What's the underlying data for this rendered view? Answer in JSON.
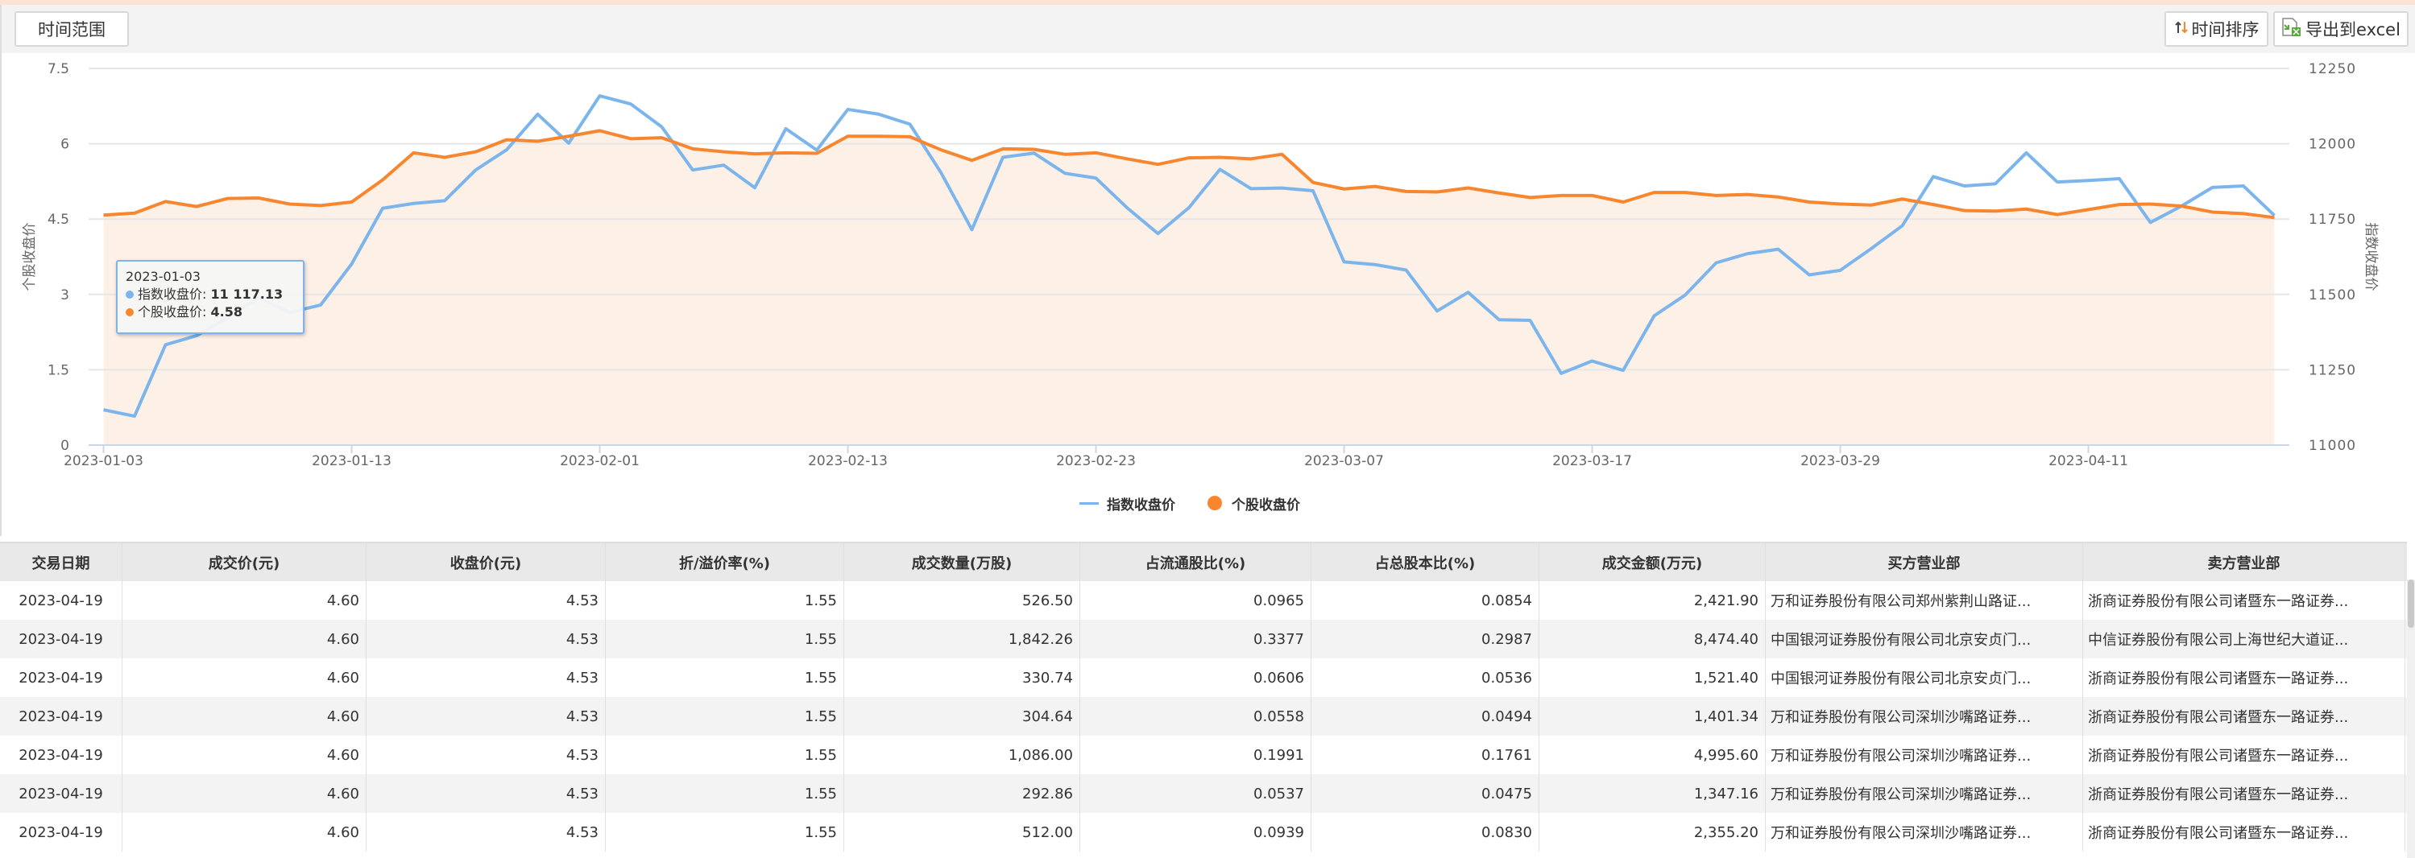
{
  "toolbar": {
    "range_label": "时间范围",
    "sort_label": "时间排序",
    "export_label": "导出到excel"
  },
  "tooltip": {
    "date": "2023-01-03",
    "index_label": "指数收盘价:",
    "index_value": "11 117.13",
    "stock_label": "个股收盘价:",
    "stock_value": "4.58"
  },
  "chart_data": {
    "type": "line",
    "left_axis": {
      "title": "个股收盘价",
      "ylim": [
        0,
        7.5
      ],
      "ticks": [
        "0",
        "1.5",
        "3",
        "4.5",
        "6",
        "7.5"
      ]
    },
    "right_axis": {
      "title": "指数收盘价",
      "ylim": [
        11000,
        12250
      ],
      "ticks": [
        "11000",
        "11250",
        "11500",
        "11750",
        "12000",
        "12250"
      ]
    },
    "x_tick_labels": [
      "2023-01-03",
      "2023-01-13",
      "2023-02-01",
      "2023-02-13",
      "2023-02-23",
      "2023-03-07",
      "2023-03-17",
      "2023-03-29",
      "2023-04-11"
    ],
    "x": [
      "2023-01-03",
      "2023-01-04",
      "2023-01-05",
      "2023-01-06",
      "2023-01-09",
      "2023-01-10",
      "2023-01-11",
      "2023-01-12",
      "2023-01-13",
      "2023-01-16",
      "2023-01-17",
      "2023-01-18",
      "2023-01-19",
      "2023-01-20",
      "2023-01-30",
      "2023-01-31",
      "2023-02-01",
      "2023-02-02",
      "2023-02-03",
      "2023-02-06",
      "2023-02-07",
      "2023-02-08",
      "2023-02-09",
      "2023-02-10",
      "2023-02-13",
      "2023-02-14",
      "2023-02-15",
      "2023-02-16",
      "2023-02-17",
      "2023-02-20",
      "2023-02-21",
      "2023-02-22",
      "2023-02-23",
      "2023-02-24",
      "2023-02-27",
      "2023-02-28",
      "2023-03-01",
      "2023-03-02",
      "2023-03-03",
      "2023-03-06",
      "2023-03-07",
      "2023-03-08",
      "2023-03-09",
      "2023-03-10",
      "2023-03-13",
      "2023-03-14",
      "2023-03-15",
      "2023-03-16",
      "2023-03-17",
      "2023-03-20",
      "2023-03-21",
      "2023-03-22",
      "2023-03-23",
      "2023-03-24",
      "2023-03-27",
      "2023-03-28",
      "2023-03-29",
      "2023-03-30",
      "2023-03-31",
      "2023-04-03",
      "2023-04-04",
      "2023-04-06",
      "2023-04-07",
      "2023-04-10",
      "2023-04-11",
      "2023-04-12",
      "2023-04-13",
      "2023-04-14",
      "2023-04-17",
      "2023-04-18",
      "2023-04-19"
    ],
    "series": [
      {
        "name": "指数收盘价",
        "axis": "right",
        "color": "#7cb5ec",
        "values": [
          11117.13,
          11096,
          11333,
          11363,
          11422,
          11489,
          11440,
          11465,
          11601,
          11786,
          11802,
          11811,
          11913,
          11980,
          12098,
          12002,
          12159,
          12132,
          12056,
          11913,
          11929,
          11854,
          12050,
          11979,
          12114,
          12098,
          12065,
          11905,
          11715,
          11955,
          11969,
          11902,
          11886,
          11788,
          11702,
          11788,
          11915,
          11851,
          11853,
          11844,
          11608,
          11599,
          11581,
          11445,
          11507,
          11416,
          11414,
          11238,
          11279,
          11248,
          11429,
          11498,
          11605,
          11635,
          11650,
          11565,
          11580,
          11652,
          11728,
          11891,
          11860,
          11867,
          11970,
          11873,
          11878,
          11884,
          11739,
          11793,
          11855,
          11860,
          11762
        ]
      },
      {
        "name": "个股收盘价",
        "axis": "left",
        "color": "#f7862e",
        "area": true,
        "values": [
          4.58,
          4.62,
          4.85,
          4.75,
          4.91,
          4.92,
          4.8,
          4.77,
          4.84,
          5.28,
          5.82,
          5.73,
          5.84,
          6.08,
          6.05,
          6.15,
          6.26,
          6.1,
          6.12,
          5.9,
          5.84,
          5.8,
          5.82,
          5.81,
          6.15,
          6.15,
          6.14,
          5.88,
          5.67,
          5.9,
          5.89,
          5.79,
          5.82,
          5.7,
          5.59,
          5.72,
          5.73,
          5.7,
          5.79,
          5.23,
          5.1,
          5.15,
          5.05,
          5.04,
          5.12,
          5.02,
          4.93,
          4.97,
          4.97,
          4.84,
          5.03,
          5.03,
          4.97,
          4.99,
          4.94,
          4.84,
          4.8,
          4.78,
          4.9,
          4.79,
          4.67,
          4.66,
          4.7,
          4.59,
          4.69,
          4.79,
          4.8,
          4.76,
          4.64,
          4.61,
          4.53
        ]
      }
    ],
    "legend": [
      "指数收盘价",
      "个股收盘价"
    ],
    "legend_position": "bottom-center",
    "grid": true
  },
  "table": {
    "columns": [
      "交易日期",
      "成交价(元)",
      "收盘价(元)",
      "折/溢价率(%)",
      "成交数量(万股)",
      "占流通股比(%)",
      "占总股本比(%)",
      "成交金额(万元)",
      "买方营业部",
      "卖方营业部"
    ],
    "rows": [
      [
        "2023-04-19",
        "4.60",
        "4.53",
        "1.55",
        "526.50",
        "0.0965",
        "0.0854",
        "2,421.90",
        "万和证券股份有限公司郑州紫荆山路证...",
        "浙商证券股份有限公司诸暨东一路证券..."
      ],
      [
        "2023-04-19",
        "4.60",
        "4.53",
        "1.55",
        "1,842.26",
        "0.3377",
        "0.2987",
        "8,474.40",
        "中国银河证券股份有限公司北京安贞门...",
        "中信证券股份有限公司上海世纪大道证..."
      ],
      [
        "2023-04-19",
        "4.60",
        "4.53",
        "1.55",
        "330.74",
        "0.0606",
        "0.0536",
        "1,521.40",
        "中国银河证券股份有限公司北京安贞门...",
        "浙商证券股份有限公司诸暨东一路证券..."
      ],
      [
        "2023-04-19",
        "4.60",
        "4.53",
        "1.55",
        "304.64",
        "0.0558",
        "0.0494",
        "1,401.34",
        "万和证券股份有限公司深圳沙嘴路证券...",
        "浙商证券股份有限公司诸暨东一路证券..."
      ],
      [
        "2023-04-19",
        "4.60",
        "4.53",
        "1.55",
        "1,086.00",
        "0.1991",
        "0.1761",
        "4,995.60",
        "万和证券股份有限公司深圳沙嘴路证券...",
        "浙商证券股份有限公司诸暨东一路证券..."
      ],
      [
        "2023-04-19",
        "4.60",
        "4.53",
        "1.55",
        "292.86",
        "0.0537",
        "0.0475",
        "1,347.16",
        "万和证券股份有限公司深圳沙嘴路证券...",
        "浙商证券股份有限公司诸暨东一路证券..."
      ],
      [
        "2023-04-19",
        "4.60",
        "4.53",
        "1.55",
        "512.00",
        "0.0939",
        "0.0830",
        "2,355.20",
        "万和证券股份有限公司深圳沙嘴路证券...",
        "浙商证券股份有限公司诸暨东一路证券..."
      ]
    ]
  }
}
